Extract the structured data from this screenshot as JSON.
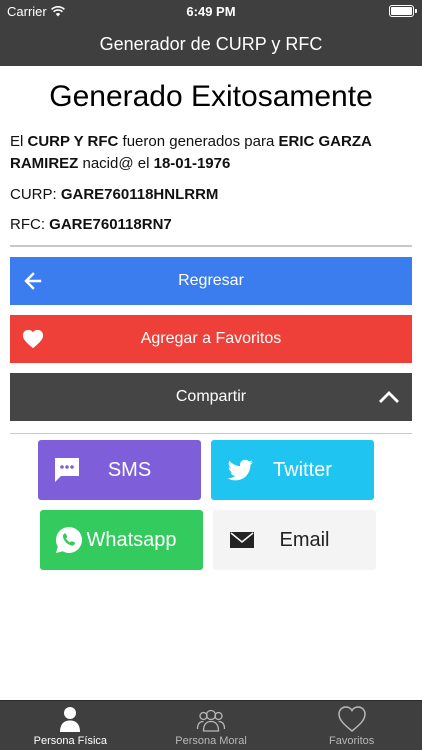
{
  "status_bar": {
    "carrier": "Carrier",
    "time": "6:49 PM"
  },
  "nav": {
    "title": "Generador de CURP y RFC"
  },
  "result": {
    "heading": "Generado Exitosamente",
    "prefix": "El",
    "curp_rfc": "CURP Y RFC",
    "middle": "fueron generados para",
    "name": "ERIC GARZA RAMIREZ",
    "born": "nacid@ el",
    "birthdate": "18-01-1976",
    "curp_label": "CURP:",
    "curp_value": "GARE760118HNLRRM",
    "rfc_label": "RFC:",
    "rfc_value": "GARE760118RN7"
  },
  "actions": {
    "back": "Regresar",
    "favorite": "Agregar a Favoritos",
    "share": "Compartir"
  },
  "share_options": {
    "sms": "SMS",
    "twitter": "Twitter",
    "whatsapp": "Whatsapp",
    "email": "Email"
  },
  "tabs": [
    {
      "label": "Persona Física",
      "icon": "person-icon"
    },
    {
      "label": "Persona Moral",
      "icon": "group-icon"
    },
    {
      "label": "Favoritos",
      "icon": "heart-icon"
    }
  ],
  "colors": {
    "bar": "#3f3f3f",
    "back": "#3b7dee",
    "favorite": "#ee3f38",
    "share": "#454545",
    "sms": "#7f5fd9",
    "twitter": "#1fc4f0",
    "whatsapp": "#33cb5d",
    "email": "#f4f4f4"
  }
}
